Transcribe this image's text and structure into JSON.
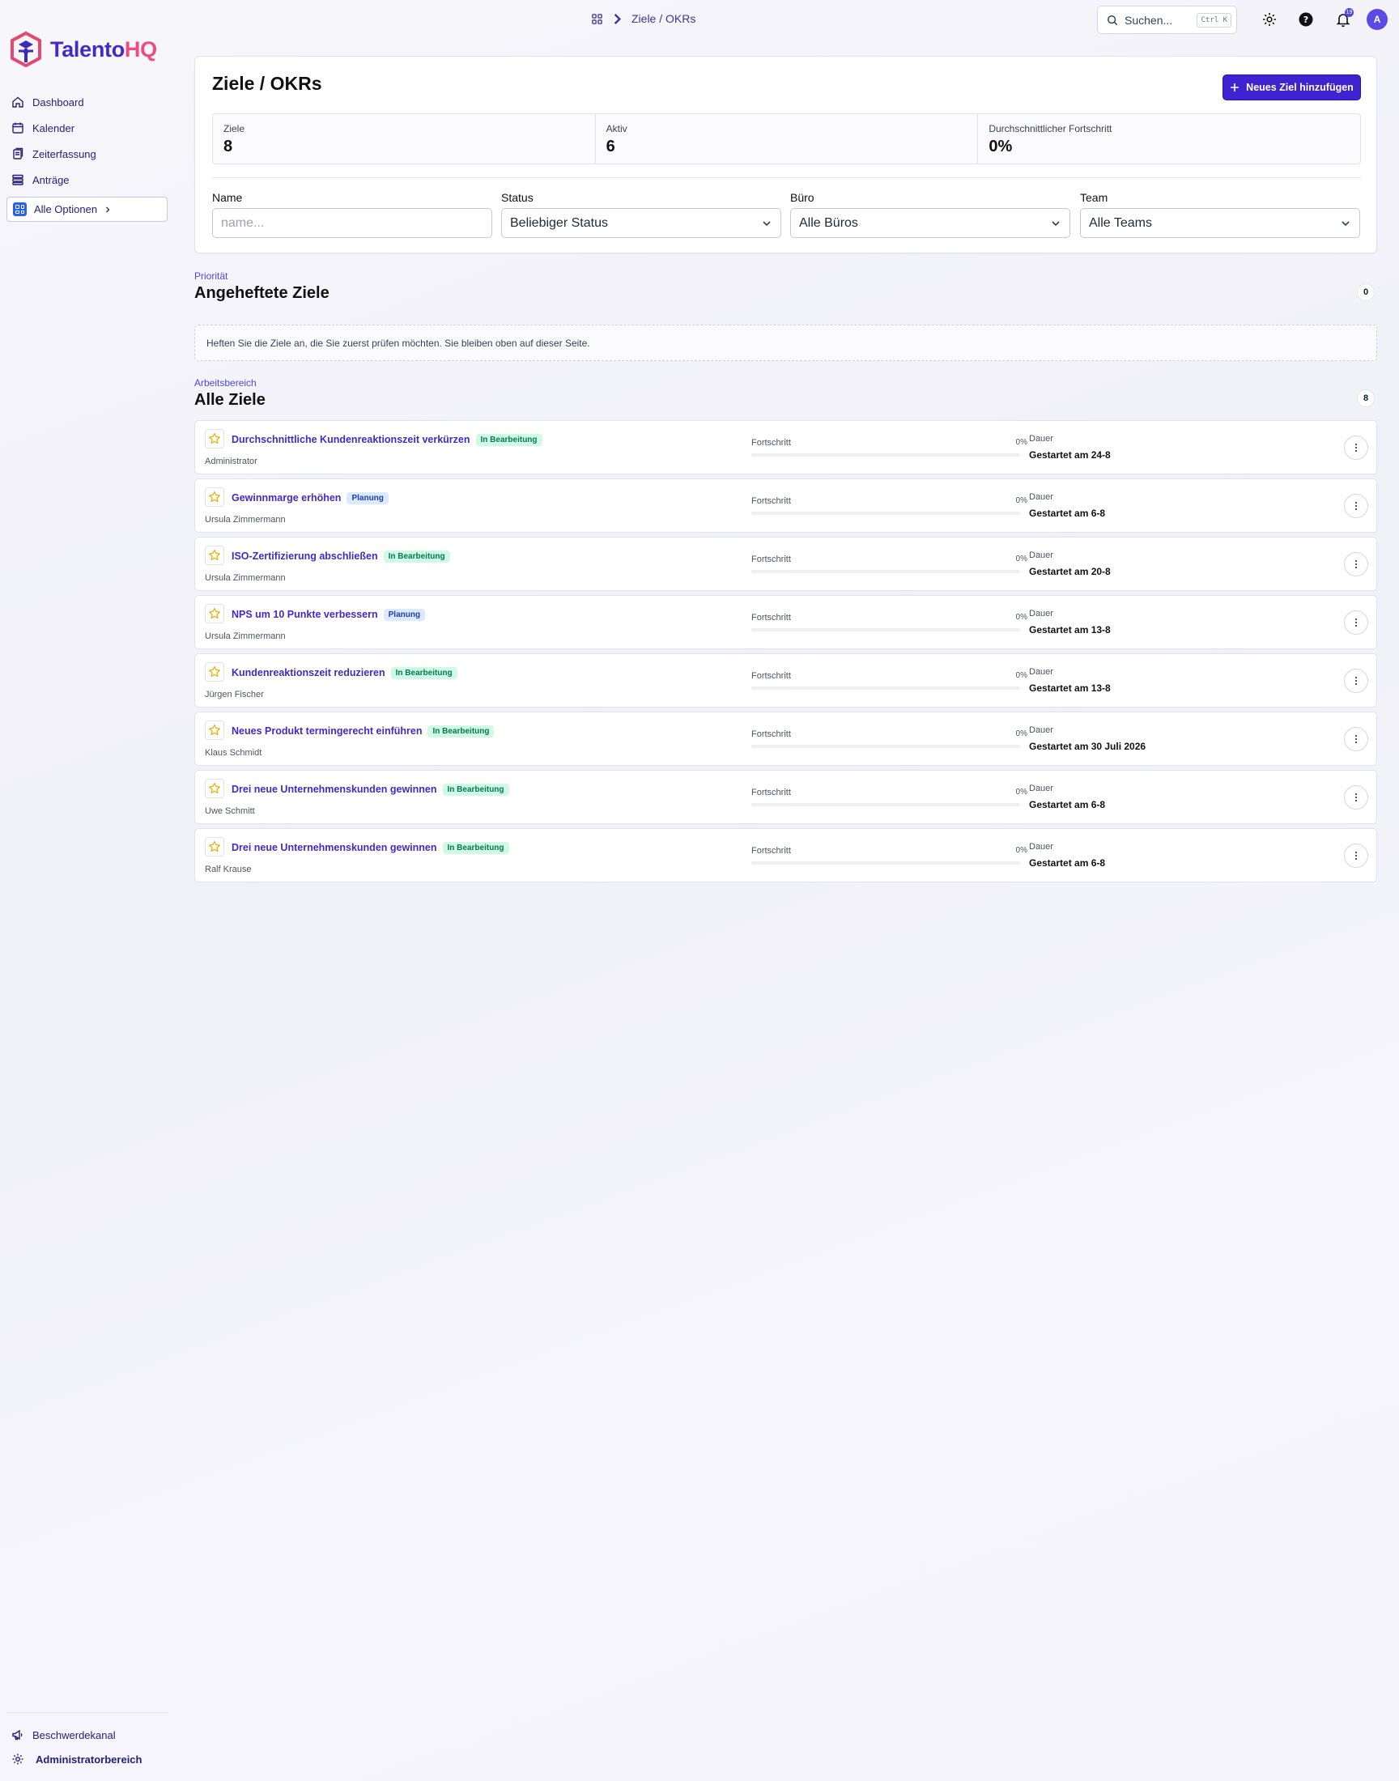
{
  "brand": {
    "part1": "Talento",
    "part2": "HQ"
  },
  "sidebar": {
    "items": [
      {
        "label": "Dashboard",
        "icon": "home-icon"
      },
      {
        "label": "Kalender",
        "icon": "calendar-icon"
      },
      {
        "label": "Zeiterfassung",
        "icon": "timesheet-icon"
      },
      {
        "label": "Anträge",
        "icon": "requests-icon"
      }
    ],
    "all_options": "Alle Optionen",
    "bottom": [
      {
        "label": "Beschwerdekanal",
        "icon": "megaphone-icon"
      },
      {
        "label": "Administratorbereich",
        "icon": "gear-icon"
      }
    ]
  },
  "topbar": {
    "breadcrumb": "Ziele / OKRs",
    "search_placeholder": "Suchen...",
    "search_shortcut": "Ctrl K",
    "notification_count": "19",
    "avatar_initial": "A"
  },
  "header": {
    "title": "Ziele / OKRs",
    "new_button": "Neues Ziel hinzufügen",
    "stats": [
      {
        "label": "Ziele",
        "value": "8"
      },
      {
        "label": "Aktiv",
        "value": "6"
      },
      {
        "label": "Durchschnittlicher Fortschritt",
        "value": "0%"
      }
    ],
    "filters": {
      "name_label": "Name",
      "name_placeholder": "name...",
      "status_label": "Status",
      "status_value": "Beliebiger Status",
      "office_label": "Büro",
      "office_value": "Alle Büros",
      "team_label": "Team",
      "team_value": "Alle Teams"
    }
  },
  "pinned": {
    "kicker": "Priorität",
    "title": "Angeheftete Ziele",
    "count": "0",
    "empty_text": "Heften Sie die Ziele an, die Sie zuerst prüfen möchten. Sie bleiben oben auf dieser Seite."
  },
  "all_goals": {
    "kicker": "Arbeitsbereich",
    "title": "Alle Ziele",
    "count": "8",
    "progress_label": "Fortschritt",
    "duration_label": "Dauer",
    "items": [
      {
        "title": "Durchschnittliche Kundenreaktionszeit verkürzen",
        "status": "In Bearbeitung",
        "status_kind": "green",
        "owner": "Administrator",
        "progress": "0%",
        "duration": "Gestartet am 24-8"
      },
      {
        "title": "Gewinnmarge erhöhen",
        "status": "Planung",
        "status_kind": "blue",
        "owner": "Ursula Zimmermann",
        "progress": "0%",
        "duration": "Gestartet am 6-8"
      },
      {
        "title": "ISO-Zertifizierung abschließen",
        "status": "In Bearbeitung",
        "status_kind": "green",
        "owner": "Ursula Zimmermann",
        "progress": "0%",
        "duration": "Gestartet am 20-8"
      },
      {
        "title": "NPS um 10 Punkte verbessern",
        "status": "Planung",
        "status_kind": "blue",
        "owner": "Ursula Zimmermann",
        "progress": "0%",
        "duration": "Gestartet am 13-8"
      },
      {
        "title": "Kundenreaktionszeit reduzieren",
        "status": "In Bearbeitung",
        "status_kind": "green",
        "owner": "Jürgen Fischer",
        "progress": "0%",
        "duration": "Gestartet am 13-8"
      },
      {
        "title": "Neues Produkt termingerecht einführen",
        "status": "In Bearbeitung",
        "status_kind": "green",
        "owner": "Klaus Schmidt",
        "progress": "0%",
        "duration": "Gestartet am 30 Juli 2026"
      },
      {
        "title": "Drei neue Unternehmenskunden gewinnen",
        "status": "In Bearbeitung",
        "status_kind": "green",
        "owner": "Uwe Schmitt",
        "progress": "0%",
        "duration": "Gestartet am 6-8"
      },
      {
        "title": "Drei neue Unternehmenskunden gewinnen",
        "status": "In Bearbeitung",
        "status_kind": "green",
        "owner": "Ralf Krause",
        "progress": "0%",
        "duration": "Gestartet am 6-8"
      }
    ]
  }
}
